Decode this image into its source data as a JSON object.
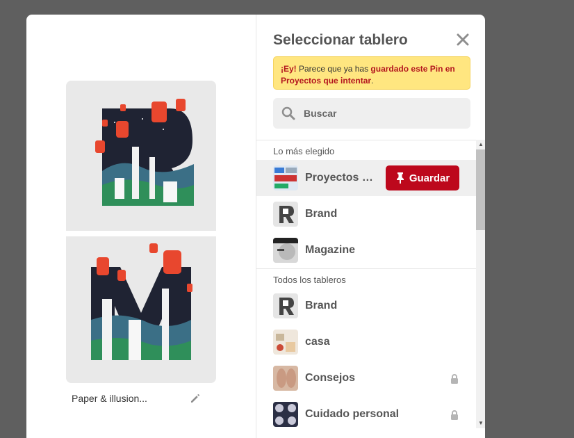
{
  "pin": {
    "caption": "Paper & illusion..."
  },
  "panel": {
    "title": "Seleccionar tablero",
    "notice": {
      "prefix": "¡Ey!",
      "text": " Parece que ya has ",
      "highlight": "guardado este Pin en Proyectos que intentar",
      "suffix": "."
    },
    "search_placeholder": "Buscar",
    "sections": {
      "top": "Lo más elegido",
      "all": "Todos los tableros"
    },
    "top_boards": [
      {
        "name": "Proyectos que intentar",
        "action": "Guardar"
      },
      {
        "name": "Brand"
      },
      {
        "name": "Magazine"
      }
    ],
    "all_boards": [
      {
        "name": "Brand",
        "secret": false
      },
      {
        "name": "casa",
        "secret": false
      },
      {
        "name": "Consejos",
        "secret": true
      },
      {
        "name": "Cuidado personal",
        "secret": true
      }
    ]
  },
  "colors": {
    "accent": "#bd081c",
    "notice_bg": "#ffe680",
    "backdrop": "#5f5f5f"
  }
}
